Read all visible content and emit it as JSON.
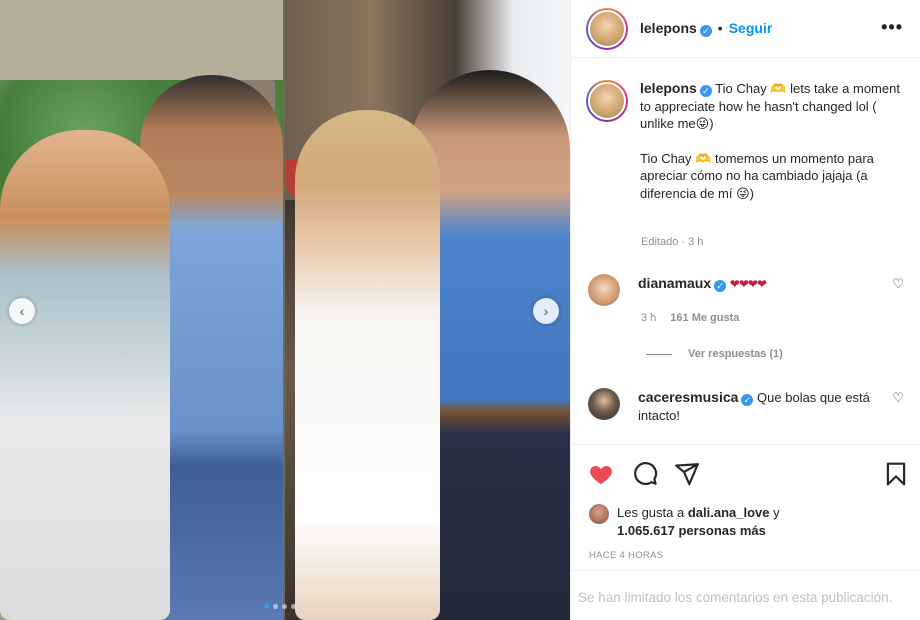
{
  "post": {
    "username": "lelepons",
    "follow_label": "Seguir",
    "header_separator": "•",
    "more_label": "•••",
    "verified_mark": "✓",
    "caption_en": "Tio Chay 🫶 lets take a moment to appreciate how he hasn't changed lol ( unlike me😜)",
    "caption_es": "Tio Chay 🫶 tomemos un momento para apreciar cómo no ha cambiado jajaja (a diferencia de mí 😜)",
    "edited_meta": "Editado · 3 h",
    "time_ago": "HACE 4 HORAS",
    "comments_limited": "Se han limitado los comentarios en esta publicación."
  },
  "carousel": {
    "prev_label": "‹",
    "next_label": "›",
    "slide_count": 4,
    "active_index": 0
  },
  "comments": [
    {
      "username": "dianamaux",
      "text": "❤❤❤❤",
      "age": "3 h",
      "likes": "161 Me gusta",
      "replies": "Ver respuestas (1)"
    },
    {
      "username": "caceresmusica",
      "text": "Que bolas que está intacto!"
    }
  ],
  "likes_summary": {
    "prefix": "Les gusta a ",
    "user": "dali.ana_love",
    "connector": " y",
    "others": "1.065.617 personas más"
  },
  "colors": {
    "link_blue": "#0095f6",
    "like_red": "#ed4956",
    "muted": "#8e8e8e"
  },
  "icons": {
    "like": "heart-filled-icon",
    "comment": "comment-bubble-icon",
    "share": "paper-plane-icon",
    "save": "bookmark-icon"
  }
}
